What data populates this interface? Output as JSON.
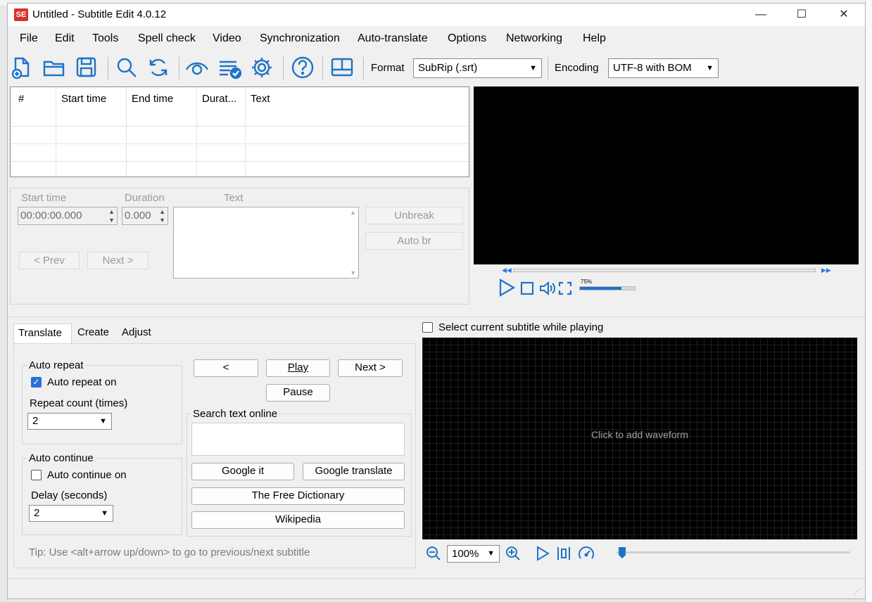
{
  "window": {
    "title": "Untitled - Subtitle Edit 4.0.12",
    "app_icon_text": "SE",
    "minimize": "—",
    "maximize": "☐",
    "close": "✕"
  },
  "menu": [
    "File",
    "Edit",
    "Tools",
    "Spell check",
    "Video",
    "Synchronization",
    "Auto-translate",
    "Options",
    "Networking",
    "Help"
  ],
  "toolbar": {
    "icons": [
      "new-icon",
      "open-icon",
      "save-icon",
      "find-icon",
      "replace-icon",
      "visual-sync-icon",
      "spell-check-icon",
      "settings-icon",
      "help-icon",
      "layout-icon"
    ],
    "format_label": "Format",
    "format_value": "SubRip (.srt)",
    "encoding_label": "Encoding",
    "encoding_value": "UTF-8 with BOM"
  },
  "grid": {
    "columns": [
      "#",
      "Start time",
      "End time",
      "Durat...",
      "Text"
    ]
  },
  "editor": {
    "start_time_label": "Start time",
    "duration_label": "Duration",
    "text_label": "Text",
    "start_time_value": "00:00:00.000",
    "duration_value": "0.000",
    "unbreak": "Unbreak",
    "auto_br": "Auto br",
    "prev": "< Prev",
    "next": "Next >"
  },
  "video": {
    "volume_label": "75%",
    "volume_level": 0.75
  },
  "tabs": [
    "Translate",
    "Create",
    "Adjust"
  ],
  "translate": {
    "auto_repeat_legend": "Auto repeat",
    "auto_repeat_on": "Auto repeat on",
    "auto_repeat_checked": true,
    "repeat_count_label": "Repeat count (times)",
    "repeat_count_value": "2",
    "auto_continue_legend": "Auto continue",
    "auto_continue_on": "Auto continue on",
    "auto_continue_checked": false,
    "delay_label": "Delay (seconds)",
    "delay_value": "2",
    "prev_btn": "<",
    "play_btn": "Play",
    "next_btn": "Next >",
    "pause_btn": "Pause",
    "search_legend": "Search text online",
    "google_it": "Google it",
    "google_translate": "Google translate",
    "free_dictionary": "The Free Dictionary",
    "wikipedia": "Wikipedia",
    "tip": "Tip: Use <alt+arrow up/down> to go to previous/next subtitle"
  },
  "waveform": {
    "select_current": "Select current subtitle while playing",
    "placeholder": "Click to add waveform",
    "zoom_value": "100%"
  }
}
